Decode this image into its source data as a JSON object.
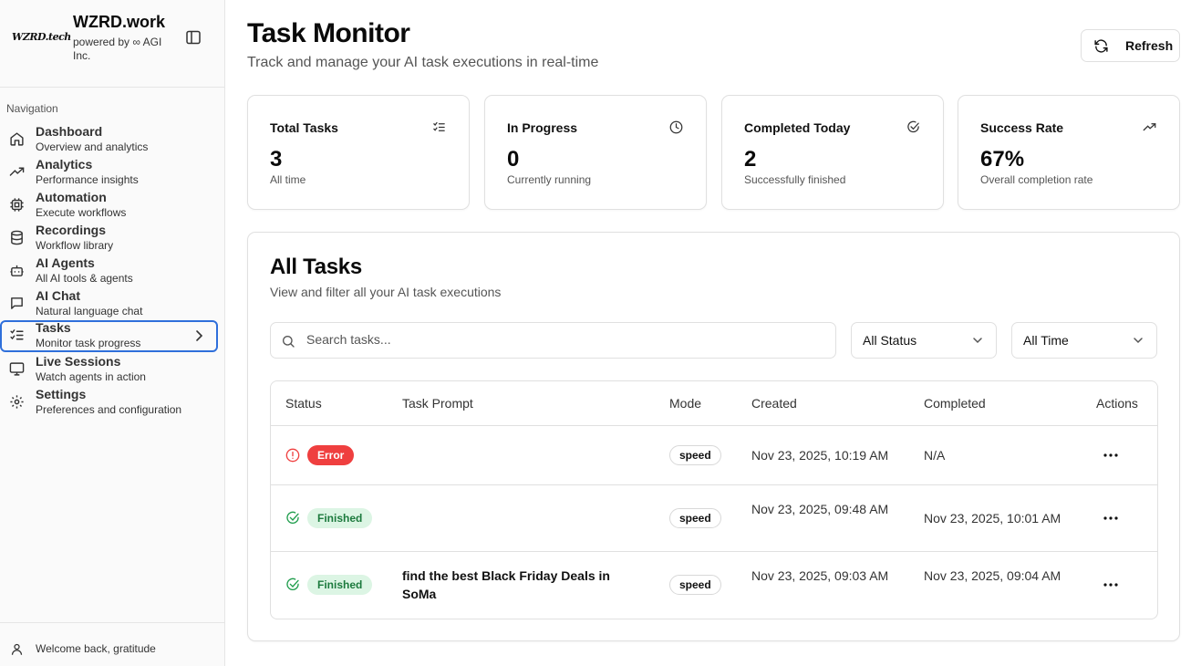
{
  "sidebar": {
    "logo_text": "WZRD.tech",
    "brand_title": "WZRD.work",
    "brand_subtitle": "powered by ∞ AGI Inc.",
    "nav_heading": "Navigation",
    "items": [
      {
        "label": "Dashboard",
        "desc": "Overview and analytics",
        "icon": "home-icon"
      },
      {
        "label": "Analytics",
        "desc": "Performance insights",
        "icon": "trending-up-icon"
      },
      {
        "label": "Automation",
        "desc": "Execute workflows",
        "icon": "cpu-icon"
      },
      {
        "label": "Recordings",
        "desc": "Workflow library",
        "icon": "database-icon"
      },
      {
        "label": "AI Agents",
        "desc": "All AI tools & agents",
        "icon": "bot-icon"
      },
      {
        "label": "AI Chat",
        "desc": "Natural language chat",
        "icon": "message-icon"
      },
      {
        "label": "Tasks",
        "desc": "Monitor task progress",
        "icon": "list-checks-icon",
        "active": true
      },
      {
        "label": "Live Sessions",
        "desc": "Watch agents in action",
        "icon": "monitor-icon"
      },
      {
        "label": "Settings",
        "desc": "Preferences and configuration",
        "icon": "gear-icon"
      }
    ],
    "footer_text": "Welcome back, gratitude"
  },
  "header": {
    "title": "Task Monitor",
    "subtitle": "Track and manage your AI task executions in real-time",
    "refresh_label": "Refresh"
  },
  "stats": [
    {
      "title": "Total Tasks",
      "value": "3",
      "desc": "All time",
      "icon": "list-checks-icon"
    },
    {
      "title": "In Progress",
      "value": "0",
      "desc": "Currently running",
      "icon": "clock-icon"
    },
    {
      "title": "Completed Today",
      "value": "2",
      "desc": "Successfully finished",
      "icon": "check-circle-icon"
    },
    {
      "title": "Success Rate",
      "value": "67%",
      "desc": "Overall completion rate",
      "icon": "trending-up-icon"
    }
  ],
  "tasks": {
    "title": "All Tasks",
    "subtitle": "View and filter all your AI task executions",
    "search_placeholder": "Search tasks...",
    "status_filter": "All Status",
    "time_filter": "All Time",
    "columns": [
      "Status",
      "Task Prompt",
      "Mode",
      "Created",
      "Completed",
      "Actions"
    ],
    "rows": [
      {
        "status": "Error",
        "prompt": "",
        "mode": "speed",
        "created": "Nov 23, 2025, 10:19 AM",
        "completed": "N/A"
      },
      {
        "status": "Finished",
        "prompt": "",
        "mode": "speed",
        "created": "Nov 23, 2025, 09:48 AM",
        "completed": "Nov 23, 2025, 10:01 AM"
      },
      {
        "status": "Finished",
        "prompt": "find the best Black Friday Deals in SoMa",
        "mode": "speed",
        "created": "Nov 23, 2025, 09:03 AM",
        "completed": "Nov 23, 2025, 09:04 AM"
      }
    ]
  },
  "colors": {
    "accent": "#2f6fdb",
    "error": "#ef3f3f",
    "success_bg": "#dcf5e4",
    "success_text": "#1c7a3d"
  }
}
